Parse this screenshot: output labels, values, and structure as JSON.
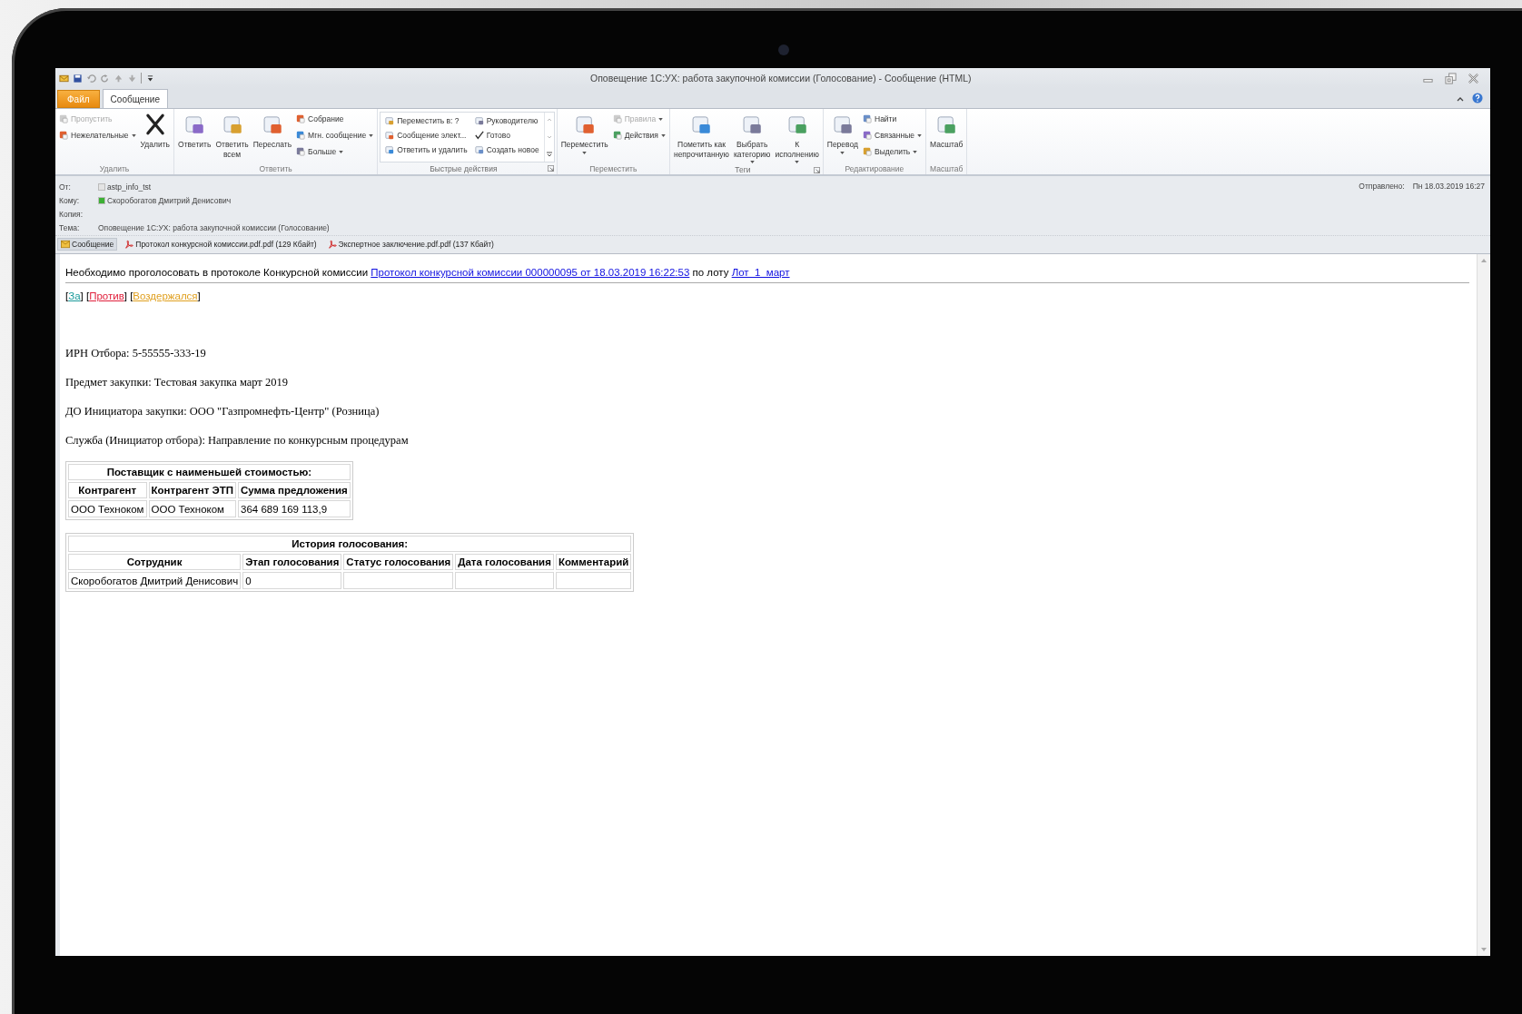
{
  "window": {
    "title": "Оповещение 1С:УХ: работа закупочной комиссии (Голосование)  -  Сообщение (HTML)"
  },
  "tabs": [
    {
      "label": "Файл",
      "kind": "file",
      "selected": false
    },
    {
      "label": "Сообщение",
      "kind": "tab",
      "selected": true
    }
  ],
  "ribbon": {
    "groups": [
      {
        "name": "Удалить",
        "launcher": false,
        "columns": [
          {
            "kind": "stack",
            "items": [
              {
                "label": "Пропустить",
                "disabled": true,
                "dropdown": false
              },
              {
                "label": "Нежелательные",
                "disabled": false,
                "dropdown": true
              }
            ]
          },
          {
            "kind": "large",
            "label": "Удалить",
            "disabled": false,
            "dropdown": false
          }
        ]
      },
      {
        "name": "Ответить",
        "launcher": false,
        "columns": [
          {
            "kind": "large",
            "label": "Ответить",
            "disabled": false,
            "dropdown": false
          },
          {
            "kind": "large",
            "label": "Ответить\nвсем",
            "disabled": false,
            "dropdown": false
          },
          {
            "kind": "large",
            "label": "Переслать",
            "disabled": false,
            "dropdown": false
          },
          {
            "kind": "stack",
            "items": [
              {
                "label": "Собрание",
                "disabled": false,
                "dropdown": false
              },
              {
                "label": "Мгн. сообщение",
                "disabled": false,
                "dropdown": true
              },
              {
                "label": "Больше",
                "disabled": false,
                "dropdown": true
              }
            ]
          }
        ]
      },
      {
        "name": "Быстрые действия",
        "launcher": true,
        "columns": [
          {
            "kind": "gallery",
            "items": [
              {
                "label": "Переместить в: ?"
              },
              {
                "label": "Сообщение элект..."
              },
              {
                "label": "Ответить и удалить"
              },
              {
                "label": "Руководителю"
              },
              {
                "label": "Готово"
              },
              {
                "label": "Создать новое"
              }
            ]
          }
        ]
      },
      {
        "name": "Переместить",
        "launcher": false,
        "columns": [
          {
            "kind": "large",
            "label": "Переместить",
            "disabled": false,
            "dropdown": true
          },
          {
            "kind": "stack",
            "items": [
              {
                "label": "Правила",
                "disabled": true,
                "dropdown": true
              },
              {
                "label": "Действия",
                "disabled": false,
                "dropdown": true
              }
            ]
          }
        ]
      },
      {
        "name": "Теги",
        "launcher": true,
        "columns": [
          {
            "kind": "large",
            "label": "Пометить как\nнепрочитанную",
            "disabled": false,
            "dropdown": false
          },
          {
            "kind": "large",
            "label": "Выбрать\nкатегорию",
            "disabled": false,
            "dropdown": true
          },
          {
            "kind": "large",
            "label": "К\nисполнению",
            "disabled": false,
            "dropdown": true
          }
        ]
      },
      {
        "name": "Редактирование",
        "launcher": false,
        "columns": [
          {
            "kind": "large",
            "label": "Перевод",
            "disabled": false,
            "dropdown": true
          },
          {
            "kind": "stack",
            "items": [
              {
                "label": "Найти",
                "disabled": false,
                "dropdown": false
              },
              {
                "label": "Связанные",
                "disabled": false,
                "dropdown": true
              },
              {
                "label": "Выделить",
                "disabled": false,
                "dropdown": true
              }
            ]
          }
        ]
      },
      {
        "name": "Масштаб",
        "launcher": false,
        "columns": [
          {
            "kind": "large",
            "label": "Масштаб",
            "disabled": false,
            "dropdown": false
          }
        ]
      }
    ]
  },
  "header": {
    "fields": [
      {
        "label": "От:",
        "value": "astp_info_tst",
        "color": "#e4e4e4"
      },
      {
        "label": "Кому:",
        "value": "Скоробогатов Дмитрий Денисович",
        "color": "#3cb034"
      },
      {
        "label": "Копия:"
      },
      {
        "label": "Тема:",
        "value": "Оповещение 1С:УХ: работа закупочной комиссии (Голосование)"
      }
    ],
    "sent": {
      "label": "Отправлено:",
      "value": "Пн 18.03.2019 16:27"
    }
  },
  "attachments": [
    {
      "label": "Сообщение",
      "kind": "message",
      "selected": true
    },
    {
      "label": "Протокол конкурсной комиссии.pdf.pdf (129 Кбайт)",
      "kind": "pdf",
      "selected": false
    },
    {
      "label": "Экспертное заключение.pdf.pdf (137 Кбайт)",
      "kind": "pdf",
      "selected": false
    }
  ],
  "body": {
    "intro": [
      {
        "kind": "text",
        "text": "Необходимо проголосовать в протоколе Конкурсной комиссии "
      },
      {
        "kind": "link",
        "text": "Протокол конкурсной комиссии 000000095 от 18.03.2019 16:22:53"
      },
      {
        "kind": "text",
        "text": " по лоту "
      },
      {
        "kind": "link",
        "text": "Лот_1_март"
      }
    ],
    "vote": [
      {
        "kind": "text",
        "text": "["
      },
      {
        "kind": "link",
        "text": "За",
        "color": "#1a9a9a"
      },
      {
        "kind": "text",
        "text": "] ["
      },
      {
        "kind": "link",
        "text": "Против",
        "color": "#e0203c"
      },
      {
        "kind": "text",
        "text": "] ["
      },
      {
        "kind": "link",
        "text": "Воздержался",
        "color": "#e0a020"
      },
      {
        "kind": "text",
        "text": "]"
      }
    ],
    "paragraphs": [
      "ИРН Отбора: 5-55555-333-19",
      "Предмет закупки: Тестовая закупка март 2019",
      "ДО Инициатора закупки: ООО \"Газпромнефть-Центр\" (Розница)",
      "Служба (Инициатор отбора): Направление по конкурсным процедурам"
    ],
    "tables": [
      {
        "title": "Поставщик с наименьшей стоимостью:",
        "columns": [
          "Контрагент",
          "Контрагент ЭТП",
          "Сумма предложения"
        ],
        "rows": [
          [
            "ООО Техноком",
            "ООО Техноком",
            "364 689 169 113,9"
          ]
        ]
      },
      {
        "title": "История голосования:",
        "columns": [
          "Сотрудник",
          "Этап голосования",
          "Статус голосования",
          "Дата голосования",
          "Комментарий"
        ],
        "rows": [
          [
            "Скоробогатов Дмитрий Денисович",
            "0"
          ]
        ]
      }
    ]
  }
}
